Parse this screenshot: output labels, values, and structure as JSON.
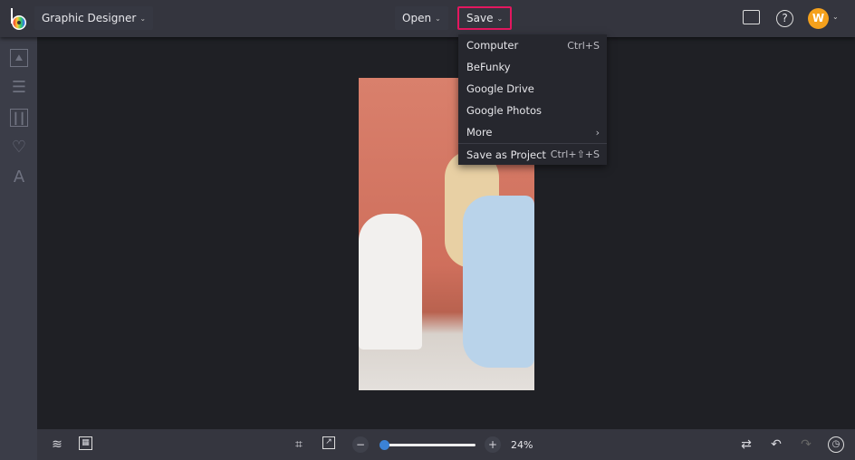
{
  "header": {
    "app_mode": "Graphic Designer",
    "open_label": "Open",
    "save_label": "Save",
    "avatar_initial": "W"
  },
  "save_menu": {
    "items": [
      {
        "label": "Computer",
        "shortcut": "Ctrl+S"
      },
      {
        "label": "BeFunky",
        "shortcut": ""
      },
      {
        "label": "Google Drive",
        "shortcut": ""
      },
      {
        "label": "Google Photos",
        "shortcut": ""
      },
      {
        "label": "More",
        "shortcut": "›"
      },
      {
        "label": "Save as Project",
        "shortcut": "Ctrl+⇧+S"
      }
    ]
  },
  "sidebar": [
    "image-manager",
    "edit",
    "layouts",
    "graphics",
    "text"
  ],
  "toolbar": {
    "zoom_label": "24%",
    "zoom_value": 24
  },
  "colors": {
    "accent": "#e3175f",
    "slider": "#3b82d6",
    "avatar": "#f5a11c"
  }
}
